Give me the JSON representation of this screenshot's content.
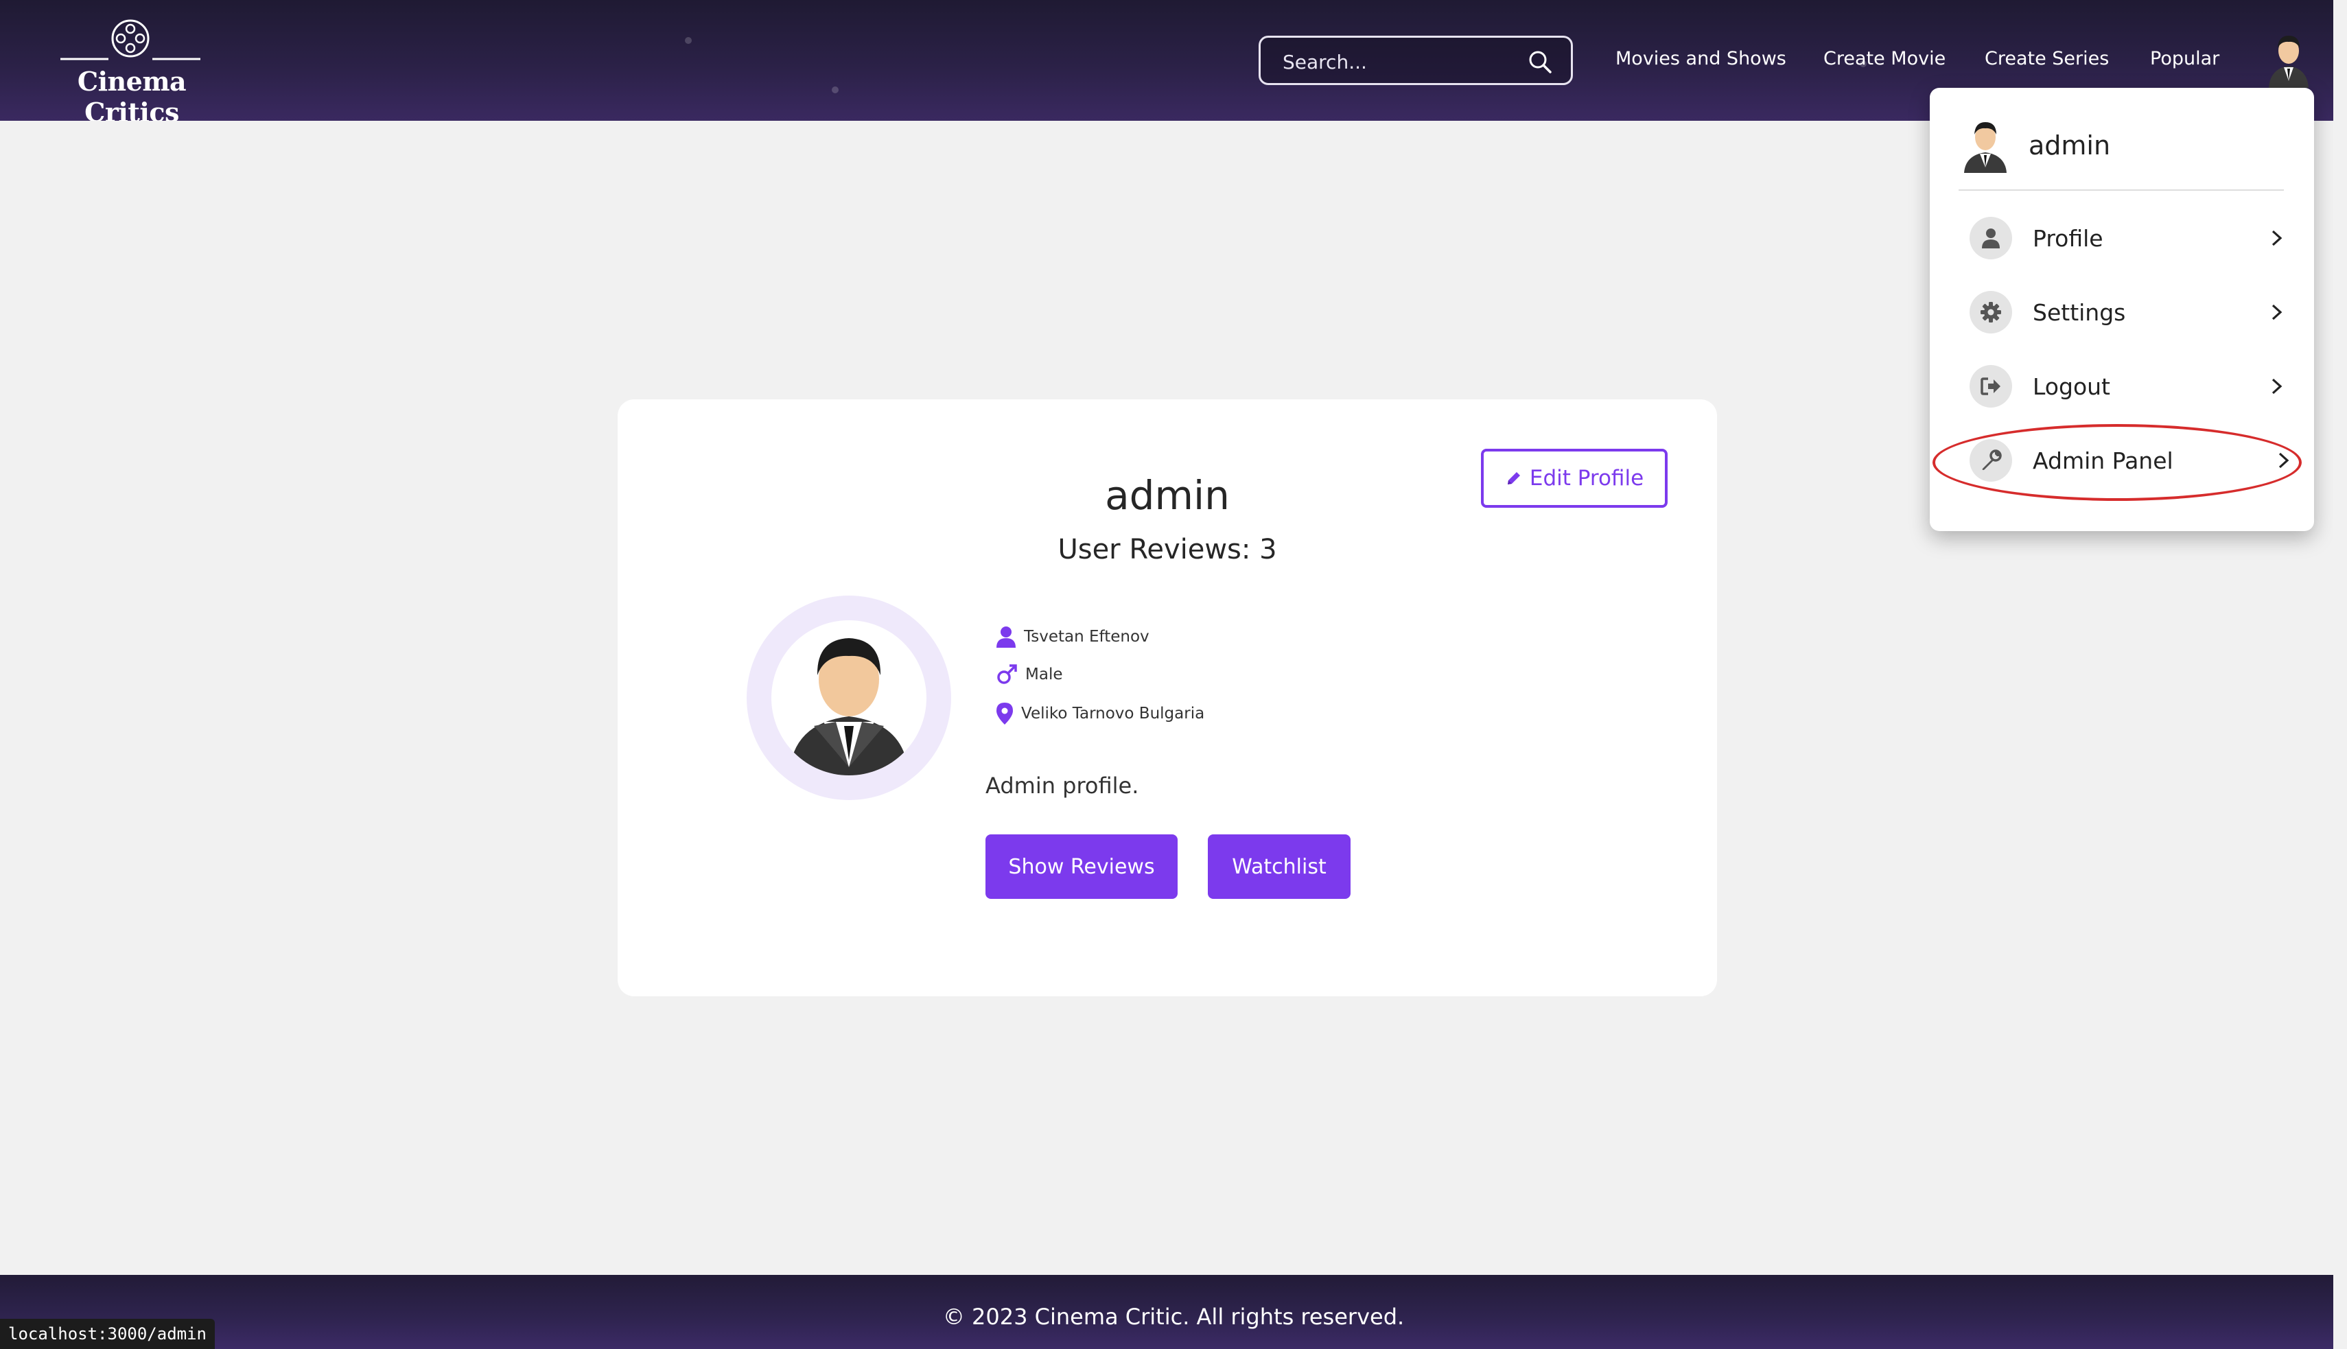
{
  "header": {
    "logo_text": "Cinema Critics",
    "search_placeholder": "Search...",
    "nav": [
      "Movies and Shows",
      "Create Movie",
      "Create Series",
      "Popular"
    ]
  },
  "profile": {
    "username": "admin",
    "reviews_label": "User Reviews: 3",
    "edit_label": "Edit Profile",
    "full_name": "Tsvetan Eftenov",
    "gender": "Male",
    "location": "Veliko Tarnovo Bulgaria",
    "bio": "Admin profile.",
    "show_reviews_label": "Show Reviews",
    "watchlist_label": "Watchlist"
  },
  "dropdown": {
    "username": "admin",
    "items": [
      {
        "label": "Profile",
        "icon": "user-icon"
      },
      {
        "label": "Settings",
        "icon": "gear-icon"
      },
      {
        "label": "Logout",
        "icon": "logout-icon"
      },
      {
        "label": "Admin Panel",
        "icon": "wrench-icon"
      }
    ]
  },
  "footer": {
    "text": "© 2023 Cinema Critic. All rights reserved."
  },
  "status_url": "localhost:3000/admin",
  "colors": {
    "accent": "#7c3aed",
    "header": "#2b2147",
    "highlight": "#d62c2c"
  }
}
